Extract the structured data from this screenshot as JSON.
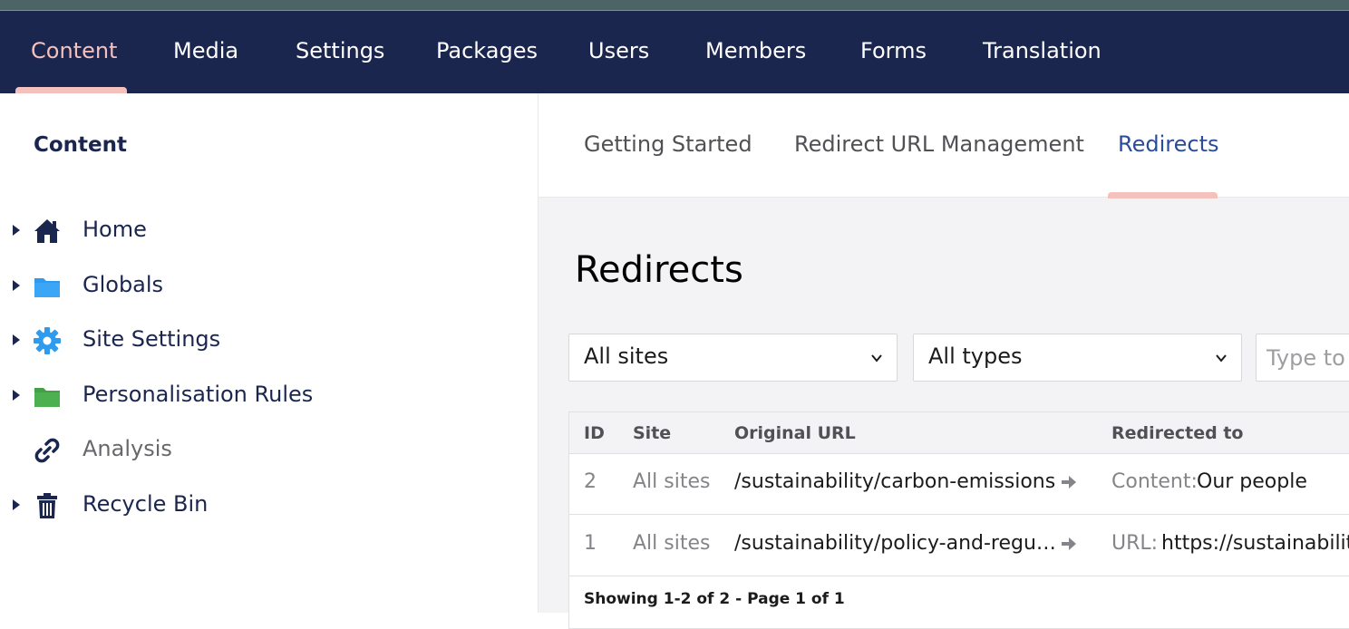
{
  "top_nav": {
    "items": [
      {
        "label": "Content",
        "active": true
      },
      {
        "label": "Media"
      },
      {
        "label": "Settings"
      },
      {
        "label": "Packages"
      },
      {
        "label": "Users"
      },
      {
        "label": "Members"
      },
      {
        "label": "Forms"
      },
      {
        "label": "Translation"
      }
    ]
  },
  "sidebar": {
    "title": "Content",
    "tree": [
      {
        "label": "Home",
        "icon": "home-icon",
        "has_children": true
      },
      {
        "label": "Globals",
        "icon": "folder-icon",
        "has_children": true,
        "icon_color": "#2f9bef"
      },
      {
        "label": "Site Settings",
        "icon": "gear-icon",
        "has_children": true,
        "icon_color": "#2f9bef"
      },
      {
        "label": "Personalisation Rules",
        "icon": "folder-icon",
        "has_children": true,
        "icon_color": "#4caf50"
      },
      {
        "label": "Analysis",
        "icon": "link-icon",
        "has_children": false,
        "muted": true
      },
      {
        "label": "Recycle Bin",
        "icon": "trash-icon",
        "has_children": true
      }
    ]
  },
  "main": {
    "tabs": [
      {
        "label": "Getting Started"
      },
      {
        "label": "Redirect URL Management"
      },
      {
        "label": "Redirects",
        "active": true
      }
    ],
    "page_title": "Redirects",
    "filters": {
      "site_select": "All sites",
      "type_select": "All types",
      "search_placeholder": "Type to search"
    },
    "table": {
      "headers": {
        "id": "ID",
        "site": "Site",
        "original": "Original URL",
        "redirected": "Redirected to"
      },
      "rows": [
        {
          "id": "2",
          "site": "All sites",
          "original": "/sustainability/carbon-emissions",
          "target_prefix": "Content:",
          "target_value": "Our people"
        },
        {
          "id": "1",
          "site": "All sites",
          "original": "/sustainability/policy-and-regu…",
          "target_prefix": "URL:",
          "target_value": "https://sustainability."
        }
      ],
      "footer": "Showing 1-2 of 2 - Page 1 of 1"
    }
  },
  "colors": {
    "nav_bg": "#1b264f",
    "accent": "#f5c1bc",
    "active_tab": "#2b4c9c"
  }
}
